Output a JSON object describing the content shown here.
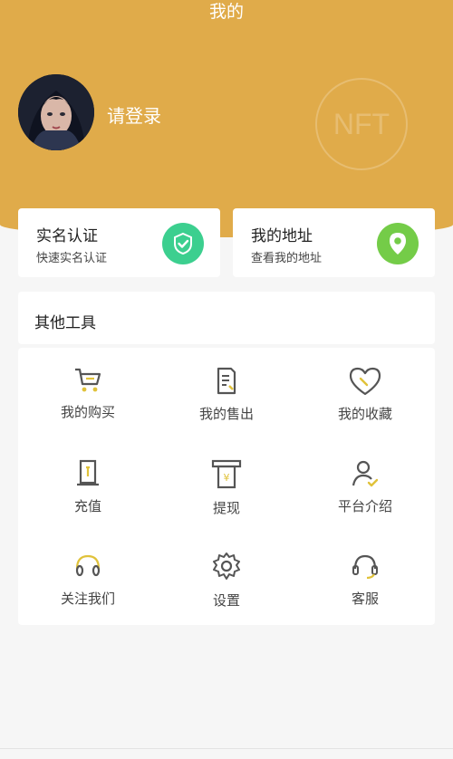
{
  "header": {
    "title": "我的",
    "login_text": "请登录",
    "watermark": "NFT"
  },
  "cards": [
    {
      "title": "实名认证",
      "subtitle": "快速实名认证",
      "icon": "verified-shield-icon",
      "color": "#3ccf8f"
    },
    {
      "title": "我的地址",
      "subtitle": "查看我的地址",
      "icon": "location-pin-icon",
      "color": "#74cc48"
    }
  ],
  "tools": {
    "title": "其他工具",
    "items": [
      {
        "label": "我的购买",
        "icon": "cart-icon"
      },
      {
        "label": "我的售出",
        "icon": "document-icon"
      },
      {
        "label": "我的收藏",
        "icon": "heart-icon"
      },
      {
        "label": "充值",
        "icon": "wallet-icon"
      },
      {
        "label": "提现",
        "icon": "atm-icon"
      },
      {
        "label": "平台介绍",
        "icon": "user-icon"
      },
      {
        "label": "关注我们",
        "icon": "headset-icon"
      },
      {
        "label": "设置",
        "icon": "gear-icon"
      },
      {
        "label": "客服",
        "icon": "support-icon"
      }
    ]
  },
  "colors": {
    "header_bg": "#e0ab4a",
    "accent_yellow": "#e0c23a",
    "verify_green": "#3ccf8f",
    "address_green": "#74cc48"
  }
}
